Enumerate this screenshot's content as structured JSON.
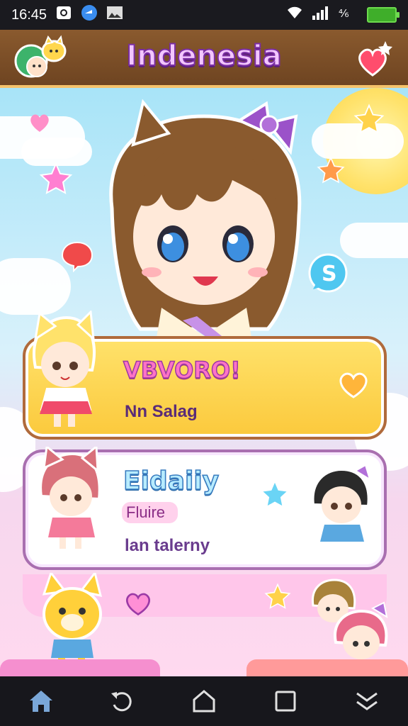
{
  "status_bar": {
    "time": "16:45",
    "battery_level": 0.85,
    "icons": [
      "camera-icon",
      "app-badge-icon",
      "gallery-icon",
      "wifi-icon",
      "signal-icon",
      "network-icon",
      "battery-icon"
    ]
  },
  "header": {
    "title": "Indenesia",
    "left_icon": "mascot-avatar-icon",
    "right_icon": "heart-star-icon"
  },
  "cards": [
    {
      "title": "VBVORO!",
      "subtitle": "Nn Salag",
      "icon": "heart-icon",
      "color": "#fbc93c"
    },
    {
      "title": "Eidaiiy",
      "tag": "Fluire",
      "subtitle": "lan talerny",
      "icon": "star-icon",
      "color": "#ffffff"
    }
  ],
  "nav": {
    "items": [
      "home-icon",
      "back-rotate-icon",
      "house-outline-icon",
      "recents-icon",
      "double-chevron-down-icon"
    ]
  },
  "colors": {
    "accent_purple": "#7b2ea3",
    "header_brown": "#8a5a2e",
    "card_yellow": "#fbc93c",
    "pink": "#ff73c6",
    "sky": "#a8e4f8"
  }
}
